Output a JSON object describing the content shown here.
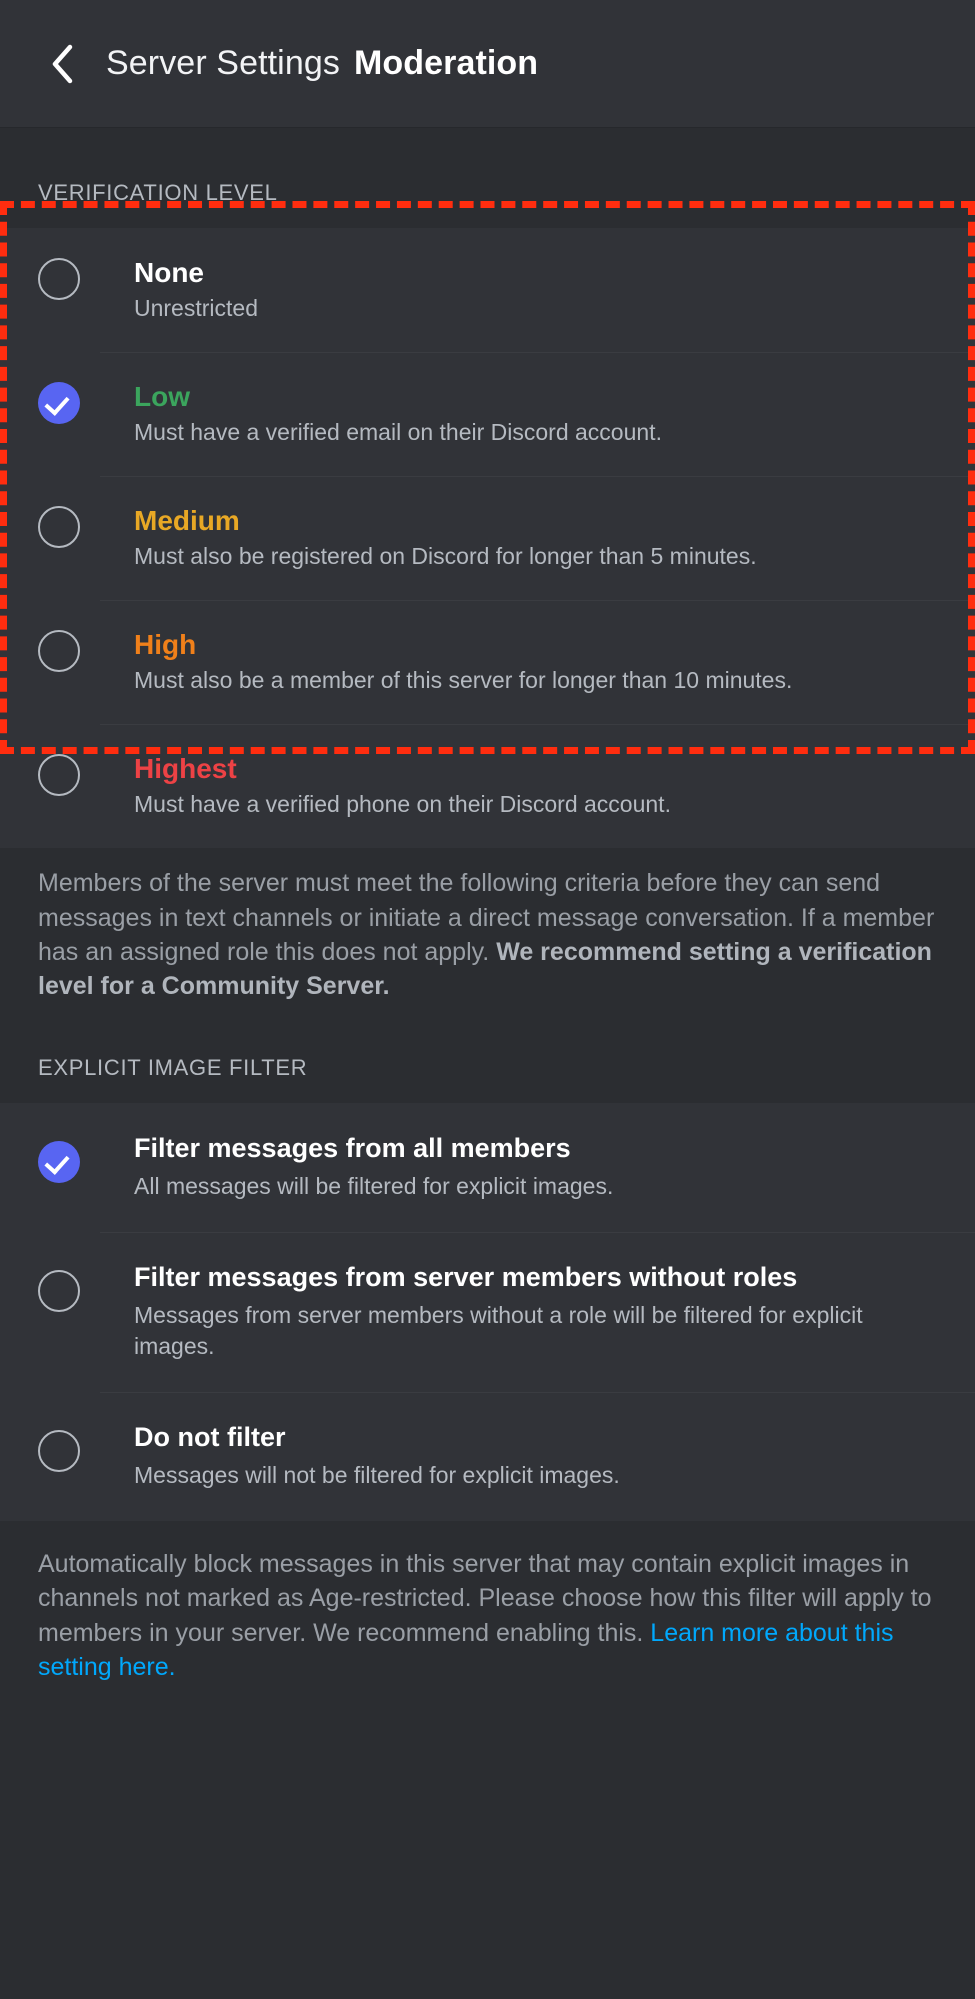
{
  "header": {
    "back_icon": "chevron-left-icon",
    "breadcrumb": "Server Settings",
    "title": "Moderation"
  },
  "verification": {
    "section_label": "VERIFICATION LEVEL",
    "options": [
      {
        "label": "None",
        "description": "Unrestricted",
        "color": "#ffffff",
        "selected": false
      },
      {
        "label": "Low",
        "description": "Must have a verified email on their Discord account.",
        "color": "#3ba55d",
        "selected": true
      },
      {
        "label": "Medium",
        "description": "Must also be registered on Discord for longer than 5 minutes.",
        "color": "#e8a825",
        "selected": false
      },
      {
        "label": "High",
        "description": "Must also be a member of this server for longer than 10 minutes.",
        "color": "#f0801a",
        "selected": false
      },
      {
        "label": "Highest",
        "description": "Must have a verified phone on their Discord account.",
        "color": "#ed4245",
        "selected": false
      }
    ],
    "description_part1": "Members of the server must meet the following criteria before they can send messages in text channels or initiate a direct message conversation. If a member has an assigned role this does not apply.",
    "description_part2": "We recommend setting a verification level for a Community Server."
  },
  "explicit_filter": {
    "section_label": "EXPLICIT IMAGE FILTER",
    "options": [
      {
        "label": "Filter messages from all members",
        "description": "All messages will be filtered for explicit images.",
        "selected": true
      },
      {
        "label": "Filter messages from server members without roles",
        "description": "Messages from server members without a role will be filtered for explicit images.",
        "selected": false
      },
      {
        "label": "Do not filter",
        "description": "Messages will not be filtered for explicit images.",
        "selected": false
      }
    ],
    "description": "Automatically block messages in this server that may contain explicit images in channels not marked as Age-restricted. Please choose how this filter will apply to members in your server. We recommend enabling this. ",
    "link_text": "Learn more about this setting here."
  },
  "annotation": {
    "type": "red-dashed-highlight",
    "color": "#ff2d0f",
    "target": "verification-level-options"
  }
}
